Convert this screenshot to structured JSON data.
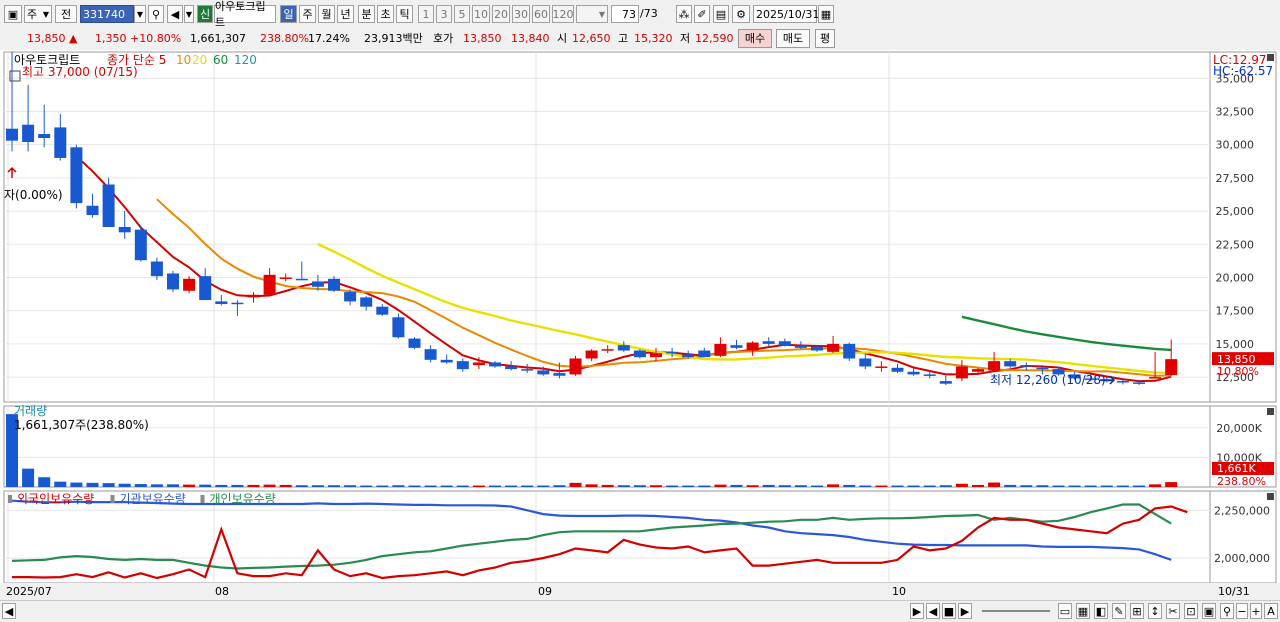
{
  "toolbar": {
    "period": "주",
    "mode": "전",
    "code": "331740",
    "tag": "신",
    "stock_name": "아우토크립트",
    "tabs": [
      "일",
      "주",
      "월",
      "년",
      "분",
      "초",
      "틱"
    ],
    "minutes": [
      "1",
      "3",
      "5",
      "10",
      "20",
      "30",
      "60",
      "120"
    ],
    "count": "73",
    "count_total": "/73",
    "date": "2025/10/31"
  },
  "info": {
    "price": "13,850 ▲",
    "change": "1,350 +10.80%",
    "volume": "1,661,307",
    "volume_ratio": "238.80%",
    "turnover": "17.24%",
    "amount": "23,913백만",
    "ask_label": "호가",
    "ask": "13,850",
    "bid": "13,840",
    "open_label": "시",
    "open": "12,650",
    "high_label": "고",
    "high": "15,320",
    "low_label": "저",
    "low": "12,590",
    "buy": "매수",
    "sell": "매도",
    "avg": "평"
  },
  "chart_data": [
    {
      "type": "candlestick",
      "title": "아우토크립트",
      "legend": [
        "종가 단순 5",
        "10",
        "20",
        "60",
        "120"
      ],
      "legend_colors": [
        "#d40000",
        "#e88a00",
        "#e8e000",
        "#1a8a3a",
        "#1a9aa8"
      ],
      "ylim": [
        10000,
        37000
      ],
      "yticks": [
        "35,000",
        "32,500",
        "30,000",
        "27,500",
        "25,000",
        "22,500",
        "20,000",
        "17,500",
        "15,000",
        "12,500"
      ],
      "lc": "LC:12.97",
      "hc": "HC:-62.57",
      "high_label": "최고 37,000 (07/15)",
      "low_label": "최저 12,260 (10/28)",
      "first_label": "자(0.00%)",
      "last_price": "13,850",
      "last_pct": "10.80%",
      "ohlc": [
        [
          31200,
          37000,
          29500,
          30300
        ],
        [
          31500,
          34500,
          29500,
          30200
        ],
        [
          30800,
          33000,
          29800,
          30500
        ],
        [
          31300,
          32300,
          28800,
          29000
        ],
        [
          29800,
          30000,
          25200,
          25600
        ],
        [
          25400,
          26300,
          24500,
          24700
        ],
        [
          27000,
          27500,
          23800,
          23800
        ],
        [
          23800,
          25000,
          22900,
          23400
        ],
        [
          23600,
          23900,
          21200,
          21300
        ],
        [
          21200,
          21500,
          19800,
          20100
        ],
        [
          20300,
          20500,
          18900,
          19100
        ],
        [
          19000,
          20100,
          18800,
          19900
        ],
        [
          20100,
          20700,
          18300,
          18300
        ],
        [
          18200,
          18700,
          17900,
          18000
        ],
        [
          18100,
          18300,
          17100,
          18000
        ],
        [
          18500,
          18900,
          18100,
          18700
        ],
        [
          18700,
          20700,
          18700,
          20200
        ],
        [
          19900,
          20300,
          19700,
          20000
        ],
        [
          19900,
          21200,
          19800,
          19800
        ],
        [
          19700,
          20200,
          19000,
          19300
        ],
        [
          19900,
          20100,
          18900,
          19000
        ],
        [
          18900,
          19100,
          17900,
          18200
        ],
        [
          18500,
          18600,
          17500,
          17800
        ],
        [
          17800,
          18000,
          17100,
          17200
        ],
        [
          17000,
          17300,
          15400,
          15500
        ],
        [
          15400,
          15500,
          14600,
          14700
        ],
        [
          14600,
          14900,
          13600,
          13800
        ],
        [
          13800,
          14200,
          13500,
          13600
        ],
        [
          13700,
          13900,
          12900,
          13100
        ],
        [
          13400,
          14000,
          13100,
          13600
        ],
        [
          13600,
          13700,
          13200,
          13300
        ],
        [
          13300,
          13700,
          13000,
          13100
        ],
        [
          13100,
          13500,
          12800,
          13000
        ],
        [
          13000,
          13300,
          12600,
          12700
        ],
        [
          12800,
          13600,
          12400,
          12600
        ],
        [
          12700,
          14100,
          12600,
          13900
        ],
        [
          13900,
          14600,
          13700,
          14500
        ],
        [
          14600,
          14900,
          14300,
          14600
        ],
        [
          14900,
          15200,
          14400,
          14500
        ],
        [
          14500,
          14600,
          13900,
          14000
        ],
        [
          14000,
          14700,
          13700,
          14300
        ],
        [
          14400,
          14700,
          14000,
          14300
        ],
        [
          14200,
          14500,
          13900,
          14000
        ],
        [
          14500,
          14700,
          14000,
          14000
        ],
        [
          14100,
          15500,
          14000,
          15000
        ],
        [
          14900,
          15300,
          14600,
          14700
        ],
        [
          14500,
          15200,
          14100,
          15100
        ],
        [
          15200,
          15500,
          14800,
          15000
        ],
        [
          15200,
          15400,
          14800,
          14900
        ],
        [
          14900,
          15200,
          14600,
          14700
        ],
        [
          14800,
          14900,
          14400,
          14500
        ],
        [
          14400,
          15600,
          14300,
          15000
        ],
        [
          15000,
          15100,
          13700,
          13900
        ],
        [
          13900,
          14200,
          13100,
          13300
        ],
        [
          13300,
          13700,
          12900,
          13300
        ],
        [
          13200,
          13500,
          12800,
          12900
        ],
        [
          12900,
          13200,
          12600,
          12700
        ],
        [
          12700,
          13000,
          12400,
          12600
        ],
        [
          12200,
          12600,
          11900,
          12000
        ],
        [
          12400,
          13800,
          12200,
          13300
        ],
        [
          12900,
          13200,
          12700,
          13100
        ],
        [
          13000,
          14400,
          12900,
          13700
        ],
        [
          13700,
          13900,
          13200,
          13300
        ],
        [
          13400,
          13600,
          13000,
          13300
        ],
        [
          13200,
          13400,
          12700,
          13100
        ],
        [
          13100,
          13300,
          12600,
          12700
        ],
        [
          12700,
          12900,
          12300,
          12400
        ],
        [
          12400,
          12700,
          12200,
          12300
        ],
        [
          12300,
          12500,
          12100,
          12200
        ],
        [
          12200,
          12400,
          11950,
          12100
        ],
        [
          12100,
          12300,
          11900,
          12000
        ],
        [
          12500,
          14400,
          12400,
          12500
        ],
        [
          12650,
          15320,
          12590,
          13850
        ]
      ]
    },
    {
      "type": "bar",
      "title": "거래량",
      "label": "1,661,307주(238.80%)",
      "yticks": [
        "20,000K",
        "10,000K"
      ],
      "ylim": [
        0,
        26000
      ],
      "last_value": "1,661K",
      "last_pct": "238.80%",
      "values": [
        24600,
        6200,
        3300,
        1800,
        1500,
        1400,
        1300,
        1100,
        1000,
        900,
        900,
        800,
        800,
        700,
        700,
        700,
        800,
        700,
        600,
        600,
        600,
        600,
        500,
        500,
        600,
        500,
        500,
        500,
        500,
        500,
        500,
        500,
        500,
        500,
        600,
        1400,
        900,
        700,
        600,
        600,
        600,
        500,
        500,
        500,
        800,
        700,
        600,
        700,
        600,
        600,
        500,
        900,
        700,
        500,
        500,
        500,
        500,
        500,
        600,
        1100,
        700,
        1500,
        700,
        600,
        600,
        500,
        500,
        500,
        500,
        500,
        500,
        900,
        1661
      ]
    },
    {
      "type": "line",
      "title": "외국인보유수량 · 기관보유수량 · 개인보유수량",
      "series_names": [
        "외국인보유수량",
        "기관보유수량",
        "개인보유수량"
      ],
      "series_colors": [
        "#d40000",
        "#2a58d8",
        "#2a8a50"
      ],
      "yticks": [
        "2,250,000",
        "2,000,000"
      ],
      "xticks": [
        "2025/07",
        "08",
        "09",
        "10",
        "10/31"
      ],
      "ylim": [
        1890000,
        2330000
      ]
    }
  ]
}
